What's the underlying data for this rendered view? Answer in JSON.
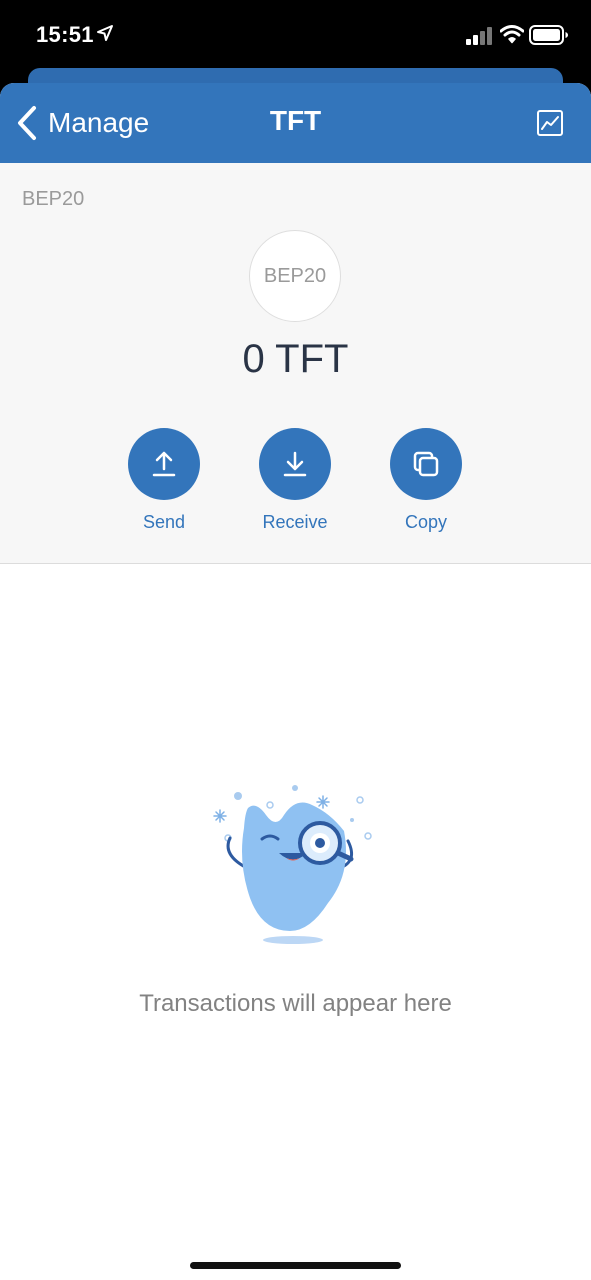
{
  "status_bar": {
    "time": "15:51",
    "icons": [
      "location-arrow-icon",
      "cellular-signal-icon",
      "wifi-icon",
      "battery-icon"
    ]
  },
  "nav": {
    "back_label": "Manage",
    "title": "TFT",
    "right_icon": "chart-icon",
    "color": "#3375bb"
  },
  "token": {
    "network": "BEP20",
    "logo_text": "BEP20",
    "balance": "0 TFT"
  },
  "actions": [
    {
      "label": "Send",
      "icon": "upload-arrow-icon"
    },
    {
      "label": "Receive",
      "icon": "download-arrow-icon"
    },
    {
      "label": "Copy",
      "icon": "copy-icon"
    }
  ],
  "empty_state": {
    "message": "Transactions will appear here",
    "illustration": "mascot-with-magnifier"
  }
}
